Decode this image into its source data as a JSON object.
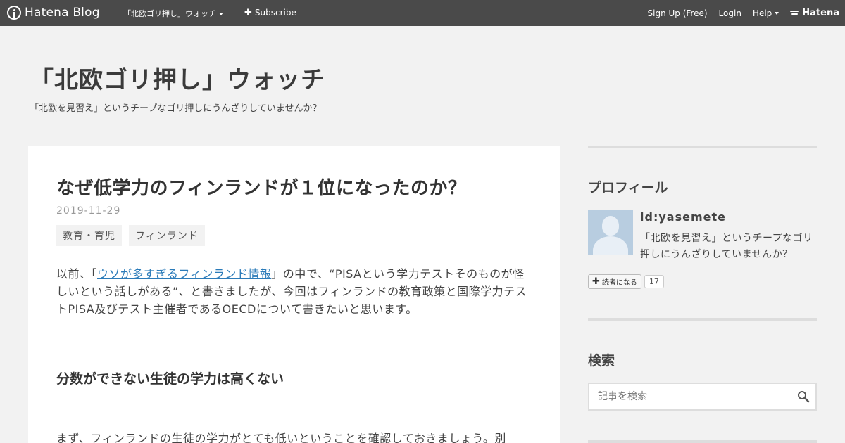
{
  "navbar": {
    "logo_text": "Hatena Blog",
    "blog_title": "「北欧ゴリ押し」ウォッチ",
    "subscribe": "Subscribe",
    "signup": "Sign Up (Free)",
    "login": "Login",
    "help": "Help",
    "brand": "Hatena"
  },
  "header": {
    "title": "「北欧ゴリ押し」ウォッチ",
    "description": "「北欧を見習え」というチープなゴリ押しにうんざりしていませんか？"
  },
  "entry": {
    "title": "なぜ低学力のフィンランドが１位になったのか？",
    "date": "2019-11-29",
    "tags": [
      "教育・育児",
      "フィンランド"
    ],
    "para1_before": "以前、「",
    "para1_link": "ウソが多すぎるフィンランド情報",
    "para1_mid": "」の中で、“PISAという学力テストそのものが怪しいという話しがある”、と書きましたが、今回はフィンランドの教育政策と国際学力テスト",
    "para1_pisa": "PISA",
    "para1_mid2": "及びテスト主催者である",
    "para1_oecd": "OECD",
    "para1_after": "について書きたいと思います。",
    "heading": "分数ができない生徒の学力は高くない",
    "para2": "まず、フィンランドの生徒の学力がとても低いということを確認しておきましょう。別"
  },
  "sidebar": {
    "profile_title": "プロフィール",
    "profile_id": "id:yasemete",
    "profile_desc": "「北欧を見習え」というチープなゴリ押しにうんざりしていませんか？",
    "reader_button": "読者になる",
    "reader_count": "17",
    "search_title": "検索",
    "search_placeholder": "記事を検索"
  },
  "colors": {
    "navbar": "#4a4a4a",
    "background": "#f2f2f2",
    "link": "#2b7bb9"
  }
}
